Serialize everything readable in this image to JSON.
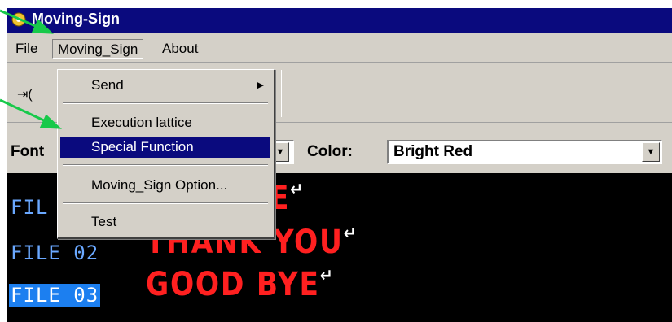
{
  "window": {
    "title": "Moving-Sign",
    "app_icon": "app-icon"
  },
  "menubar": {
    "items": [
      "File",
      "Moving_Sign",
      "About"
    ]
  },
  "dropdown": {
    "items": [
      {
        "label": "Send",
        "submenu_arrow": "▶"
      },
      {
        "label": "Execution lattice"
      },
      {
        "label": "Special Function"
      },
      {
        "label": "Moving_Sign Option..."
      },
      {
        "label": "Test"
      }
    ],
    "highlighted": "Special Function"
  },
  "fontbar": {
    "font_label": "Font",
    "color_label": "Color:",
    "color_value": "Bright Red"
  },
  "display": {
    "rows": [
      {
        "file": "FIL",
        "message": "ME",
        "return_symbol": "↵"
      },
      {
        "file": "FILE 02",
        "message": "THANK YOU",
        "return_symbol": "↵"
      },
      {
        "file": "FILE 03",
        "message": "GOOD BYE",
        "return_symbol": "↵"
      }
    ],
    "selected_file": "FILE 03"
  },
  "colors": {
    "titlebar": "#0a0a7e",
    "highlight": "#0a0a7e",
    "message_text": "#ff2020",
    "file_text": "#6aa8ff",
    "annotation_arrows": "#17c94a"
  }
}
